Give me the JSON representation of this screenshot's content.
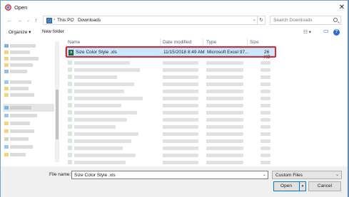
{
  "window": {
    "title": "Open",
    "close_glyph": "✕"
  },
  "nav": {
    "back_glyph": "←",
    "forward_glyph": "→",
    "recent_glyph": "⌄",
    "up_glyph": "↑",
    "breadcrumb": [
      "This PC",
      "Downloads"
    ],
    "crumb_sep": "›",
    "address_dropdown_glyph": "⌄",
    "refresh_glyph": "↻",
    "search_placeholder": "Search Downloads"
  },
  "toolbar": {
    "organize_label": "Organize ▾",
    "new_folder_label": "New folder",
    "view_glyph": "☷ ▾",
    "pane_glyph": "▭",
    "help_glyph": "?"
  },
  "columns": {
    "name": "Name",
    "date_modified": "Date modified",
    "type": "Type",
    "size": "Size"
  },
  "selected_file": {
    "name": "Size Color Style .xls",
    "date_modified": "11/15/2018 8:49 AM",
    "type": "Microsoft Excel 97...",
    "size": "26 KB",
    "icon": "excel-file-icon"
  },
  "footer": {
    "file_name_label": "File name:",
    "file_name_value": "Size Color Style .xls",
    "file_name_dropdown_glyph": "⌄",
    "filter_value": "Custom Files",
    "filter_dropdown_glyph": "⌄",
    "open_label": "Open",
    "open_split_glyph": "▾",
    "cancel_label": "Cancel"
  },
  "colors": {
    "selection_bg": "#cce8ff",
    "highlight_border": "#d82b2b",
    "excel_green": "#1e7145"
  }
}
